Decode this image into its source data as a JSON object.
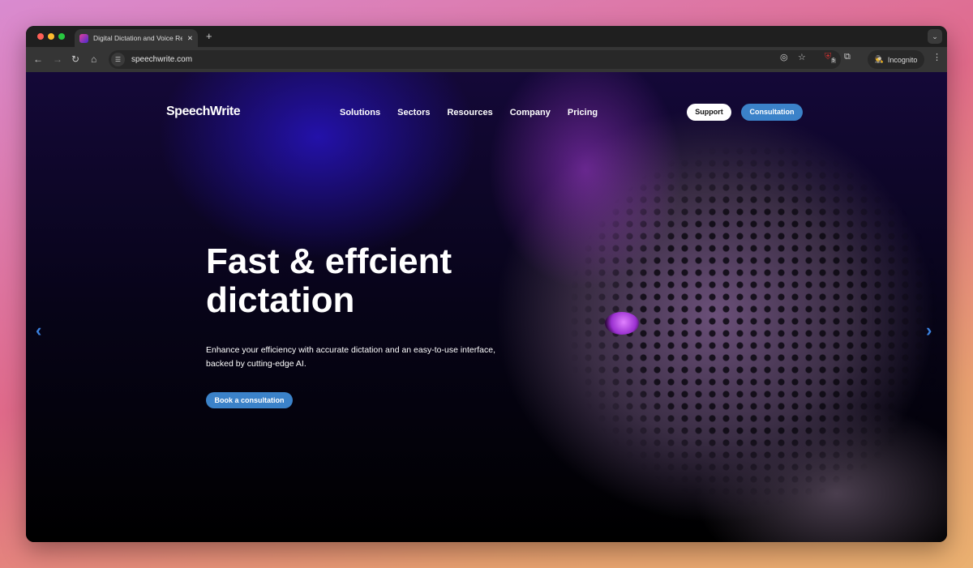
{
  "browser": {
    "tab_title": "Digital Dictation and Voice Re",
    "url": "speechwrite.com",
    "incognito_label": "Incognito",
    "extension_badge": "5"
  },
  "site": {
    "logo": "SpeechWrite",
    "nav": [
      {
        "label": "Solutions"
      },
      {
        "label": "Sectors"
      },
      {
        "label": "Resources"
      },
      {
        "label": "Company"
      },
      {
        "label": "Pricing"
      }
    ],
    "support_label": "Support",
    "consultation_label": "Consultation"
  },
  "hero": {
    "title": "Fast & effcient dictation",
    "subtitle": "Enhance your efficiency with accurate dictation and an easy-to-use interface, backed by cutting-edge AI.",
    "cta_label": "Book a consultation"
  },
  "colors": {
    "accent": "#3b82c9"
  }
}
